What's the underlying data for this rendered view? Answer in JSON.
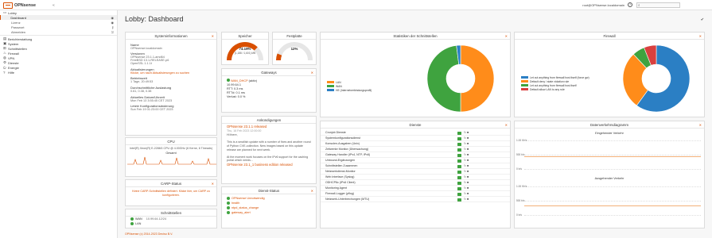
{
  "header": {
    "brand": "OPNsense",
    "collapse": "«",
    "user": "root@OPNsense.localdomain",
    "search_placeholder": ""
  },
  "sidebar": {
    "items": [
      {
        "label": "Lobby",
        "icon": "laptop-icon"
      },
      {
        "label": "Dashboard",
        "sub": true,
        "active": true,
        "right": "◉"
      },
      {
        "label": "Lizenz",
        "sub": true,
        "right": "◉"
      },
      {
        "label": "Passwort",
        "sub": true,
        "right": "⚷"
      },
      {
        "label": "Abmelden",
        "sub": true,
        "right": "⎋"
      },
      {
        "label": "Berichterstattung",
        "icon": "chart-icon"
      },
      {
        "label": "System",
        "icon": "server-icon"
      },
      {
        "label": "Schnittstellen",
        "icon": "sitemap-icon"
      },
      {
        "label": "Firewall",
        "icon": "fire-icon"
      },
      {
        "label": "VPN",
        "icon": "globe-icon"
      },
      {
        "label": "Dienste",
        "icon": "cog-icon"
      },
      {
        "label": "Energie",
        "icon": "power-icon"
      },
      {
        "label": "Hilfe",
        "icon": "help-icon"
      }
    ]
  },
  "page": {
    "title": "Lobby: Dashboard",
    "footer": "OPNsense (c) 2014-2023 Deciso B.V."
  },
  "sysinfo": {
    "title": "Systeminformationen",
    "rows": [
      {
        "k": "Name",
        "v": "OPNsense.localdomain"
      },
      {
        "k": "Versionen",
        "v": "OPNsense 23.1.1-amd64\nFreeBSD 13.1-RELEASE-p6\nOpenSSL 1.1.1t"
      },
      {
        "k": "Aktualisierungen",
        "v": "Klicke, um nach Aktualisierungen zu suchen",
        "link": true
      },
      {
        "k": "Betriebszeit",
        "v": "1 Tage, 20:49:53"
      },
      {
        "k": "Durchschnittliche Auslastung",
        "v": "0.61, 0.38, 0.38"
      },
      {
        "k": "Aktuelles Datum/Uhrzeit",
        "v": "Mon Feb 13 3:55:45 CET 2023"
      },
      {
        "k": "Letzte Konfigurationsänderung",
        "v": "Sun Feb 19 01:23:00 CET 2023"
      }
    ]
  },
  "cpu": {
    "title": "CPU",
    "model": "Intel(R) Xeon(R) E-2286G CPU @ 4.00GHz (6 Kerne, 6 Threads)",
    "label": "Gesamt"
  },
  "carp": {
    "title": "CARP-Status",
    "msg": "Keine CARP-Schnittstellen definiert. Klicke hier, um CARP zu konfigurieren."
  },
  "ifstats": {
    "title": "Schnittstellen",
    "rows": [
      {
        "name": "WAN",
        "ip": "10.99.64.12/24"
      },
      {
        "name": "LAN",
        "ip": ""
      }
    ]
  },
  "memory": {
    "title": "Speicher",
    "value": "74.19%",
    "sub": "(1,188 / 1,601) MB",
    "percent": 74.19
  },
  "disk": {
    "title": "Festplatte",
    "value": "12%",
    "percent": 12
  },
  "gateways": {
    "title": "Gateways",
    "name": "WAN_DHCP",
    "flag": "(aktiv)",
    "ip": "10.99.64.1",
    "rtt": "RTT: 0.3 ms",
    "rttd": "RTTd: 0.1 ms",
    "loss": "Verlust: 0.0 %"
  },
  "announcements": {
    "title": "Ankündigungen",
    "head1": "OPNsense 23.1.1 released",
    "date1": "Thu, 16 Feb 2023 12:00:00",
    "body1": "Hi there,\n\nThis is a smallish update with a number of fixes and another round of Python CVE-collection. New images based on this update release are planned for next week.\n\nAt the moment work focuses on the IPv6 support for the caching portal which needs...",
    "head2": "OPNsense 23.1_1 business edition released"
  },
  "services_mini": {
    "title": "Dienst-Status",
    "rows": [
      "OPNsense Unnotwendig",
      "health",
      "ntpd_status_change",
      "gateway_alert"
    ]
  },
  "traffic_donut": {
    "title": "Statistiken der Schnittstellen",
    "legend": [
      "LAN",
      "WAN",
      "HE (Internetverbindungsprofil)"
    ],
    "colors": [
      "#ff8c1a",
      "#3fa33f",
      "#2b7fc4"
    ]
  },
  "firewall": {
    "title": "Firewall",
    "legend": [
      "Let out anything from firewall host itself (force gw)",
      "Default deny / state violation rule",
      "Let out anything from firewall host itself",
      "Default allow LAN to any rule"
    ],
    "colors": [
      "#2b7fc4",
      "#ff8c1a",
      "#3fa33f",
      "#d9403f"
    ]
  },
  "services": {
    "title": "Dienste",
    "rows": [
      "Cronjob Dienste",
      "Systemkonfigurationsdienst",
      "Konsolen-Ausgaben (Unix)",
      "Zeitwerke Monitor (Überwachung)",
      "Gateway Handler (IPv4, NTP, IPv6)",
      "Unbound-Ergänzungen",
      "Schnittstellen Zusammen",
      "Netzwerkdienst-Monitor",
      "Web Interface (Syslog)",
      "ODHCP6c (IPv6 Client)",
      "Monitoring Agent",
      "Firewall-Logger (pflog)",
      "Netzwerk-Unterbrechungen (MTU)"
    ]
  },
  "traffic_graph": {
    "title": "Datenverkehrsdiagramm",
    "in_label": "Eingehender Verkehr",
    "out_label": "Ausgehender Verkehr",
    "ticks_in": [
      "1.00 Kb/s",
      "500 b/s",
      "0 b/s"
    ],
    "ticks_out": [
      "1.00 Kb/s",
      "500 b/s",
      "0 b/s"
    ]
  }
}
